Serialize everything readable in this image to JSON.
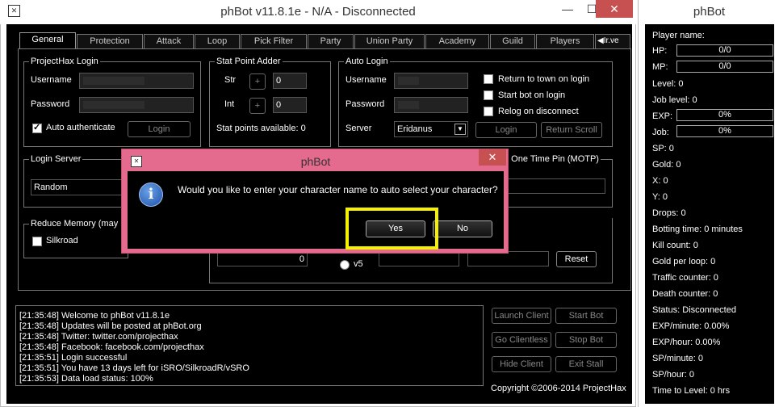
{
  "window": {
    "title": "phBot v11.8.1e - N/A - Disconnected",
    "minimize": "—",
    "maximize": "☐",
    "close": "✕"
  },
  "tabs": [
    "General",
    "Protection",
    "Attack",
    "Loop",
    "Pick Filter",
    "Party",
    "Union Party",
    "Academy",
    "Guild",
    "Players"
  ],
  "tab_scroll": "◀",
  "tab_cut": "Ir.ve",
  "projecthax": {
    "title": "ProjectHax Login",
    "username_label": "Username",
    "password_label": "Password",
    "auto_auth_label": "Auto authenticate",
    "login_button": "Login"
  },
  "stat_adder": {
    "title": "Stat Point Adder",
    "str_label": "Str",
    "int_label": "Int",
    "str_value": "0",
    "int_value": "0",
    "plus": "+",
    "available": "Stat points available: 0"
  },
  "auto_login": {
    "title": "Auto Login",
    "username_label": "Username",
    "password_label": "Password",
    "server_label": "Server",
    "server_value": "Eridanus",
    "login_button": "Login",
    "return_scroll_button": "Return Scroll",
    "return_town": "Return to town on login",
    "start_bot": "Start bot on login",
    "relog": "Relog on disconnect"
  },
  "login_server": {
    "title": "Login Server",
    "value": "Random"
  },
  "motp": {
    "title": "e One Time Pin (MOTP)"
  },
  "reduce_memory": {
    "title": "Reduce Memory (may ir",
    "silkroad": "Silkroad"
  },
  "version_box": {
    "field_value": "0",
    "v5_label": "v5",
    "reset_button": "Reset"
  },
  "log": [
    "[21:35:48] Welcome to phBot v11.8.1e",
    "[21:35:48] Updates will be posted at phBot.org",
    "[21:35:48] Twitter: twitter.com/projecthax",
    "[21:35:48] Facebook: facebook.com/projecthax",
    "[21:35:51] Login successful",
    "[21:35:51] You have 13 days left for iSRO/SilkroadR/vSRO",
    "[21:35:53] Data load status: 100%"
  ],
  "controls": {
    "launch_client": "Launch Client",
    "start_bot": "Start Bot",
    "go_clientless": "Go Clientless",
    "stop_bot": "Stop Bot",
    "hide_client": "Hide Client",
    "exit_stall": "Exit Stall"
  },
  "copyright": "Copyright ©2006-2014 ProjectHax",
  "side": {
    "title": "phBot",
    "player_name": "Player name:",
    "hp_label": "HP:",
    "hp_value": "0/0",
    "mp_label": "MP:",
    "mp_value": "0/0",
    "level": "Level: 0",
    "job_level": "Job level: 0",
    "exp_label": "EXP:",
    "exp_value": "0%",
    "job_label": "Job:",
    "job_value": "0%",
    "sp": "SP: 0",
    "gold": "Gold: 0",
    "x": "X: 0",
    "y": "Y: 0",
    "drops": "Drops: 0",
    "botting_time": "Botting time: 0 minutes",
    "kill_count": "Kill count: 0",
    "gold_per_loop": "Gold per loop: 0",
    "traffic": "Traffic counter: 0",
    "death": "Death counter: 0",
    "status": "Status: Disconnected",
    "exp_minute": "EXP/minute: 0.00%",
    "exp_hour": "EXP/hour: 0.00%",
    "sp_minute": "SP/minute: 0",
    "sp_hour": "SP/hour: 0",
    "time_to_level": "Time to Level: 0 hrs"
  },
  "dialog": {
    "title": "phBot",
    "message": "Would you like to enter your character name to auto select your character?",
    "yes": "Yes",
    "no": "No",
    "close": "✕",
    "info_glyph": "i"
  },
  "app_icon": "app-logo-icon",
  "highlight_color": "#f4f200"
}
